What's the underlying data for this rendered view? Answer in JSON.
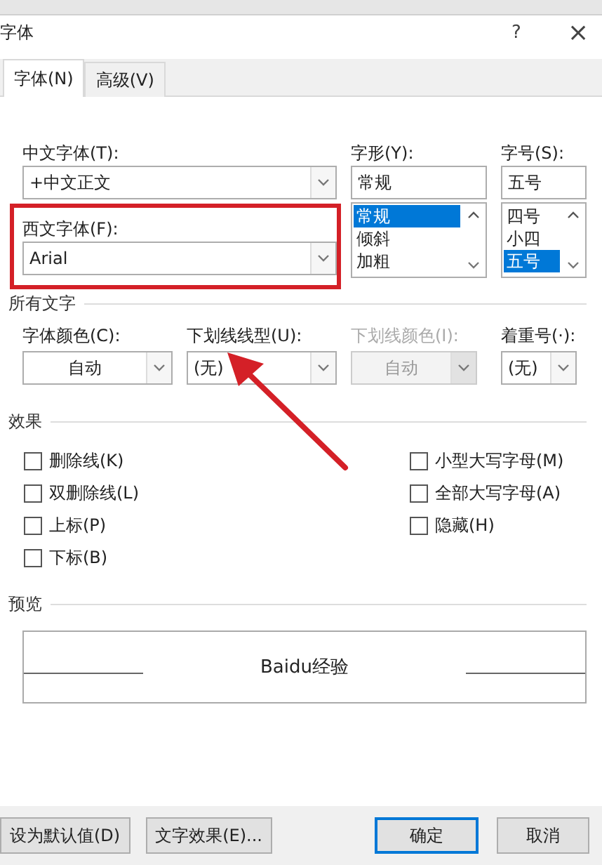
{
  "window": {
    "title": "字体",
    "help": "?",
    "close": "×"
  },
  "tabs": [
    {
      "label": "字体(N)",
      "selected": true
    },
    {
      "label": "高级(V)",
      "selected": false
    }
  ],
  "fonts": {
    "asian_label": "中文字体(T):",
    "asian_value": "+中文正文",
    "latin_label": "西文字体(F):",
    "latin_value": "Arial"
  },
  "style": {
    "label": "字形(Y):",
    "value": "常规",
    "options": [
      {
        "label": "常规",
        "selected": true
      },
      {
        "label": "倾斜",
        "selected": false
      },
      {
        "label": "加粗",
        "selected": false
      }
    ]
  },
  "size": {
    "label": "字号(S):",
    "value": "五号",
    "options": [
      {
        "label": "四号",
        "selected": false
      },
      {
        "label": "小四",
        "selected": false
      },
      {
        "label": "五号",
        "selected": true
      }
    ]
  },
  "all_text": {
    "heading": "所有文字",
    "fields": [
      {
        "label": "字体颜色(C):",
        "value": "自动",
        "kind": "color",
        "disabled": false
      },
      {
        "label": "下划线线型(U):",
        "value": "(无)",
        "kind": "list",
        "disabled": false
      },
      {
        "label": "下划线颜色(I):",
        "value": "自动",
        "kind": "color",
        "disabled": true
      },
      {
        "label": "着重号(·):",
        "value": "(无)",
        "kind": "list",
        "disabled": false
      }
    ]
  },
  "effects": {
    "heading": "效果",
    "column_1": [
      {
        "label": "删除线(K)",
        "checked": false
      },
      {
        "label": "双删除线(L)",
        "checked": false
      },
      {
        "label": "上标(P)",
        "checked": false
      },
      {
        "label": "下标(B)",
        "checked": false
      }
    ],
    "column_2": [
      {
        "label": "小型大写字母(M)",
        "checked": false
      },
      {
        "label": "全部大写字母(A)",
        "checked": false
      },
      {
        "label": "隐藏(H)",
        "checked": false
      }
    ]
  },
  "preview": {
    "heading": "预览",
    "sample": "Baidu经验"
  },
  "left_buttons": [
    {
      "label": "设为默认值(D)",
      "default": false
    },
    {
      "label": "文字效果(E)...",
      "default": false
    }
  ],
  "right_buttons": [
    {
      "label": "确定",
      "default": true
    },
    {
      "label": "取消",
      "default": false
    }
  ],
  "annotation": {
    "highlight_box": true,
    "arrow": true
  }
}
